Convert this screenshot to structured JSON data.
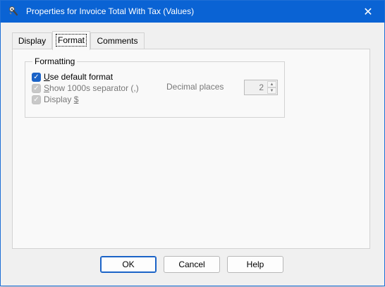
{
  "window": {
    "title": "Properties for Invoice Total With Tax (Values)",
    "close_glyph": "✕",
    "accent_color": "#0a63d4"
  },
  "tabs": [
    {
      "label": "Display",
      "active": false
    },
    {
      "label": "Format",
      "active": true
    },
    {
      "label": "Comments",
      "active": false
    }
  ],
  "formatting": {
    "group_title": "Formatting",
    "use_default": {
      "prefix": "",
      "mnemonic": "U",
      "rest": "se default format",
      "checked": true,
      "enabled": true
    },
    "show_1000s": {
      "prefix": "",
      "mnemonic": "S",
      "rest": "how 1000s separator (,)",
      "checked": true,
      "enabled": false
    },
    "display_dollar": {
      "prefix": "Display ",
      "mnemonic": "$",
      "rest": "",
      "checked": true,
      "enabled": false
    },
    "decimal_places": {
      "label": "Decimal places",
      "value": "2",
      "enabled": false
    }
  },
  "buttons": {
    "ok": "OK",
    "cancel": "Cancel",
    "help": "Help"
  },
  "icons": {
    "app": "properties-icon",
    "close": "close-icon",
    "check": "✓",
    "spin_up": "▲",
    "spin_down": "▼"
  }
}
